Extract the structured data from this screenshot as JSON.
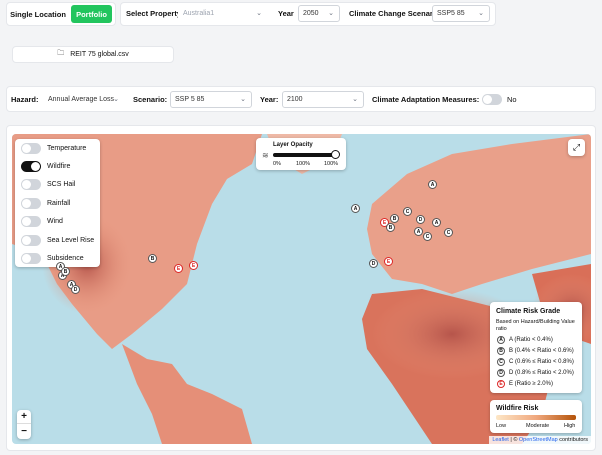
{
  "top": {
    "single_location": "Single Location",
    "portfolio": "Portfolio",
    "select_property_label": "Select Property",
    "select_property_value": "Australia1",
    "year_label": "Year",
    "year_value": "2050",
    "scenario_label": "Climate Change Scenario",
    "scenario_value": "SSP5 85"
  },
  "file": {
    "name": "REIT 75 global.csv"
  },
  "filters": {
    "hazard_label": "Hazard:",
    "hazard_value": "Annual Average Loss",
    "scenario_label": "Scenario:",
    "scenario_value": "SSP 5 85",
    "year_label": "Year:",
    "year_value": "2100",
    "adaptation_label": "Climate Adaptation Measures:",
    "adaptation_value": "No"
  },
  "layers": [
    {
      "label": "Temperature",
      "on": false
    },
    {
      "label": "Wildfire",
      "on": true
    },
    {
      "label": "SCS Hail",
      "on": false
    },
    {
      "label": "Rainfall",
      "on": false
    },
    {
      "label": "Wind",
      "on": false
    },
    {
      "label": "Sea Level Rise",
      "on": false
    },
    {
      "label": "Subsidence",
      "on": false
    }
  ],
  "opacity": {
    "title": "Layer Opacity",
    "min": "0%",
    "mid": "100%",
    "max": "100%",
    "value": 1.0
  },
  "legend": {
    "title": "Climate Risk Grade",
    "subtitle": "Based on Hazard/Building Value ratio",
    "grades": [
      {
        "letter": "A",
        "text": "A (Ratio < 0.4%)",
        "color": "#111111"
      },
      {
        "letter": "B",
        "text": "B (0.4% < Ratio < 0.6%)",
        "color": "#111111"
      },
      {
        "letter": "C",
        "text": "C (0.6% ≤ Ratio < 0.8%)",
        "color": "#111111"
      },
      {
        "letter": "D",
        "text": "D (0.8% ≤ Ratio < 2.0%)",
        "color": "#111111"
      },
      {
        "letter": "E",
        "text": "E (Ratio ≥ 2.0%)",
        "color": "#dc2626"
      }
    ]
  },
  "wildfire": {
    "title": "Wildfire Risk",
    "low": "Low",
    "mid": "Moderate",
    "high": "High"
  },
  "map": {
    "zoom_in": "+",
    "zoom_out": "−",
    "attribution_leaflet": "Leaflet",
    "attribution_sep": " | © ",
    "attribution_osm": "OpenStreetMap",
    "attribution_tail": " contributors",
    "markers": [
      {
        "letter": "A"
      },
      {
        "letter": "B"
      },
      {
        "letter": "C"
      },
      {
        "letter": "A"
      },
      {
        "letter": "D"
      },
      {
        "letter": "A"
      },
      {
        "letter": "E"
      },
      {
        "letter": "B"
      },
      {
        "letter": "A"
      },
      {
        "letter": "C"
      },
      {
        "letter": "D"
      },
      {
        "letter": "E"
      },
      {
        "letter": "B"
      },
      {
        "letter": "A"
      },
      {
        "letter": "A"
      },
      {
        "letter": "A"
      },
      {
        "letter": "E"
      },
      {
        "letter": "E"
      },
      {
        "letter": "D"
      },
      {
        "letter": "B"
      },
      {
        "letter": "C"
      }
    ]
  },
  "colors": {
    "accent": "#22c55e",
    "risk_high": "#b45309",
    "risk_low": "#fde7c7"
  }
}
